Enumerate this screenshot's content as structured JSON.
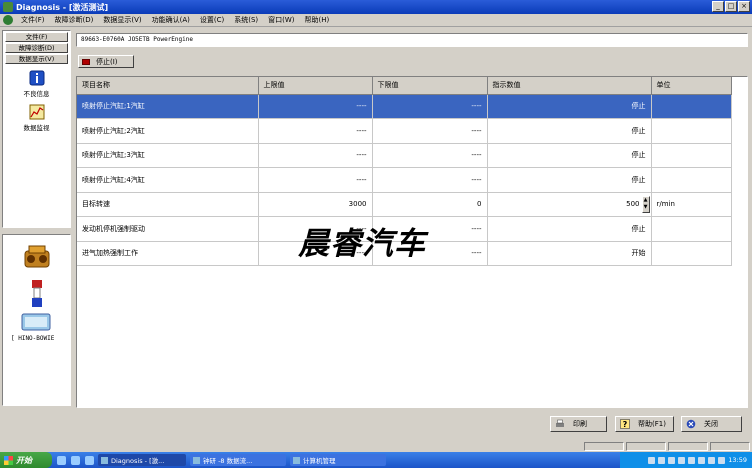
{
  "window": {
    "title": "Diagnosis - [激活测试]"
  },
  "menu": [
    "文件(F)",
    "故障诊断(D)",
    "数据显示(V)",
    "功能确认(A)",
    "设置(C)",
    "系统(S)",
    "窗口(W)",
    "帮助(H)"
  ],
  "sidebar": {
    "buttons": [
      "文件(F)",
      "故障诊断(D)",
      "数据显示(V)"
    ],
    "tools": [
      {
        "label": "不良信息",
        "icon": "info-icon"
      },
      {
        "label": "数据监视",
        "icon": "chart-icon"
      }
    ],
    "lower_label": "[ HINO-BOWIE"
  },
  "path": "89663-E0760A JO5ETB PowerEngine",
  "stop_label": "停止(I)",
  "table": {
    "headers": [
      "项目名称",
      "上限值",
      "下限值",
      "指示数值",
      "单位"
    ],
    "rows": [
      {
        "name": "喷射停止汽缸;1汽缸",
        "upper": "----",
        "lower": "----",
        "value": "停止",
        "unit": ""
      },
      {
        "name": "喷射停止汽缸;2汽缸",
        "upper": "----",
        "lower": "----",
        "value": "停止",
        "unit": ""
      },
      {
        "name": "喷射停止汽缸;3汽缸",
        "upper": "----",
        "lower": "----",
        "value": "停止",
        "unit": ""
      },
      {
        "name": "喷射停止汽缸;4汽缸",
        "upper": "----",
        "lower": "----",
        "value": "停止",
        "unit": ""
      },
      {
        "name": "目标转速",
        "upper": "3000",
        "lower": "0",
        "value": "500",
        "unit": "r/min"
      },
      {
        "name": "发动机停机强制驱动",
        "upper": "----",
        "lower": "----",
        "value": "停止",
        "unit": ""
      },
      {
        "name": "进气加热强制工作",
        "upper": "----",
        "lower": "----",
        "value": "开始",
        "unit": ""
      }
    ],
    "selected_row": 0
  },
  "watermark": "晨睿汽车",
  "actions": {
    "print": "印刷",
    "help": "帮助(F1)",
    "close": "关闭"
  },
  "taskbar": {
    "start": "开始",
    "tasks": [
      "Diagnosis - [激...",
      "钟研 -8  数据流...",
      "计算机管理"
    ],
    "clock": "13:59"
  },
  "colors": {
    "selection": "#3a65c0",
    "titlebar": "#0a3bb8",
    "taskbar": "#1c54c8"
  }
}
